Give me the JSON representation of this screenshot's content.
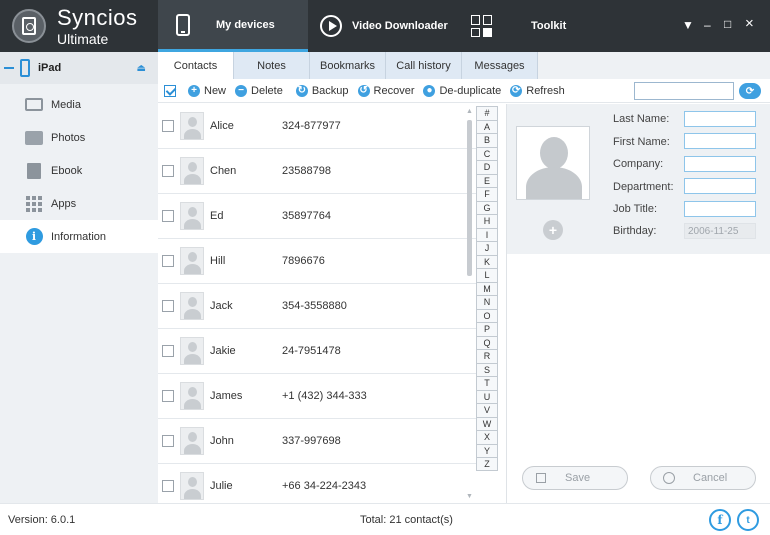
{
  "app": {
    "name": "Syncios",
    "edition": "Ultimate"
  },
  "nav": {
    "tabs": [
      {
        "label": "My devices",
        "icon": "phone-icon"
      },
      {
        "label": "Video Downloader",
        "icon": "play-icon"
      },
      {
        "label": "Toolkit",
        "icon": "grid-icon"
      }
    ],
    "active_tab": "My devices"
  },
  "window_controls": {
    "menu": "▼",
    "minimize": "–",
    "maximize": "□",
    "close": "×"
  },
  "sidebar": {
    "device": {
      "label": "iPad",
      "eject": "⏏"
    },
    "items": [
      {
        "label": "Media",
        "icon": "media-icon"
      },
      {
        "label": "Photos",
        "icon": "photos-icon"
      },
      {
        "label": "Ebook",
        "icon": "ebook-icon"
      },
      {
        "label": "Apps",
        "icon": "apps-icon"
      },
      {
        "label": "Information",
        "icon": "info-icon"
      }
    ],
    "active": "Information"
  },
  "subtabs": [
    "Contacts",
    "Notes",
    "Bookmarks",
    "Call history",
    "Messages"
  ],
  "active_subtab": "Contacts",
  "toolbar": {
    "new": "New",
    "delete": "Delete",
    "backup": "Backup",
    "recover": "Recover",
    "dedup": "De-duplicate",
    "refresh": "Refresh",
    "search_value": ""
  },
  "contacts": [
    {
      "name": "Alice",
      "phone": "324-877977"
    },
    {
      "name": "Chen",
      "phone": "23588798"
    },
    {
      "name": "Ed",
      "phone": "35897764"
    },
    {
      "name": "Hill",
      "phone": "7896676"
    },
    {
      "name": "Jack",
      "phone": "354-3558880"
    },
    {
      "name": "Jakie",
      "phone": "24-7951478"
    },
    {
      "name": "James",
      "phone": "+1 (432) 344-333"
    },
    {
      "name": "John",
      "phone": "337-997698"
    },
    {
      "name": "Julie",
      "phone": "+66 34-224-2343"
    }
  ],
  "alphabet": [
    "#",
    "A",
    "B",
    "C",
    "D",
    "E",
    "F",
    "G",
    "H",
    "I",
    "J",
    "K",
    "L",
    "M",
    "N",
    "O",
    "P",
    "Q",
    "R",
    "S",
    "T",
    "U",
    "V",
    "W",
    "X",
    "Y",
    "Z"
  ],
  "detail": {
    "labels": {
      "last_name": "Last Name:",
      "first_name": "First Name:",
      "company": "Company:",
      "department": "Department:",
      "job_title": "Job Title:",
      "birthday": "Birthday:"
    },
    "values": {
      "last_name": "",
      "first_name": "",
      "company": "",
      "department": "",
      "job_title": "",
      "birthday": "2006-11-25"
    },
    "save": "Save",
    "cancel": "Cancel"
  },
  "status": {
    "version": "Version: 6.0.1",
    "total": "Total: 21 contact(s)"
  },
  "colors": {
    "accent": "#2f9be0",
    "topbar": "#2e3337"
  }
}
